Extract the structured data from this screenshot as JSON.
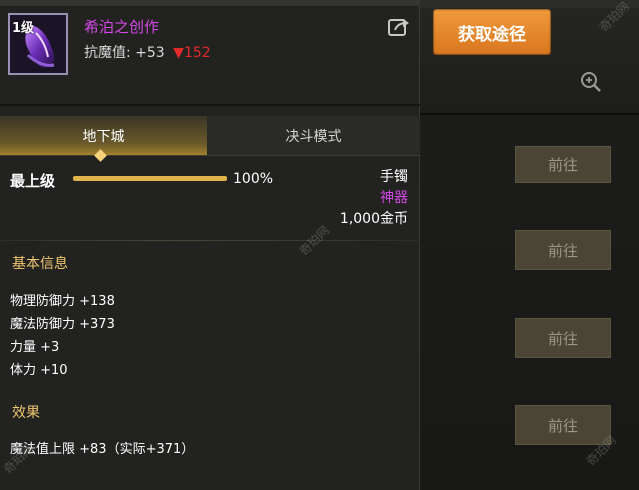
{
  "item": {
    "level_badge": "1级",
    "name": "希泊之创作",
    "stat_label": "抗魔值:",
    "stat_up": "+53",
    "stat_down": "152"
  },
  "tabs": [
    {
      "label": "地下城",
      "active": true
    },
    {
      "label": "决斗模式",
      "active": false
    }
  ],
  "grade": {
    "label": "最上级",
    "percent_text": "100%",
    "percent_value": 1.0
  },
  "info": {
    "slot_type": "手镯",
    "rarity": "神器",
    "price": "1,000金币"
  },
  "basic_section": {
    "title": "基本信息",
    "attributes": [
      "物理防御力 +138",
      "魔法防御力 +373",
      "力量 +3",
      "体力 +10"
    ]
  },
  "effect_section": {
    "title": "效果",
    "lines": [
      "魔法值上限 +83（实际+371）"
    ]
  },
  "side": {
    "acquire_button": "获取途径",
    "goto_buttons": [
      "前往",
      "前往",
      "前往",
      "前往"
    ]
  },
  "watermark": "奇珀网",
  "colors": {
    "epic_purple": "#d349e6",
    "decrease_red": "#e22a2a",
    "section_gold": "#f0c870",
    "acquire_orange": "#e8852a"
  },
  "icons": {
    "share": "share-out-icon",
    "zoom": "zoom-in-icon",
    "down": "down-triangle-icon"
  }
}
